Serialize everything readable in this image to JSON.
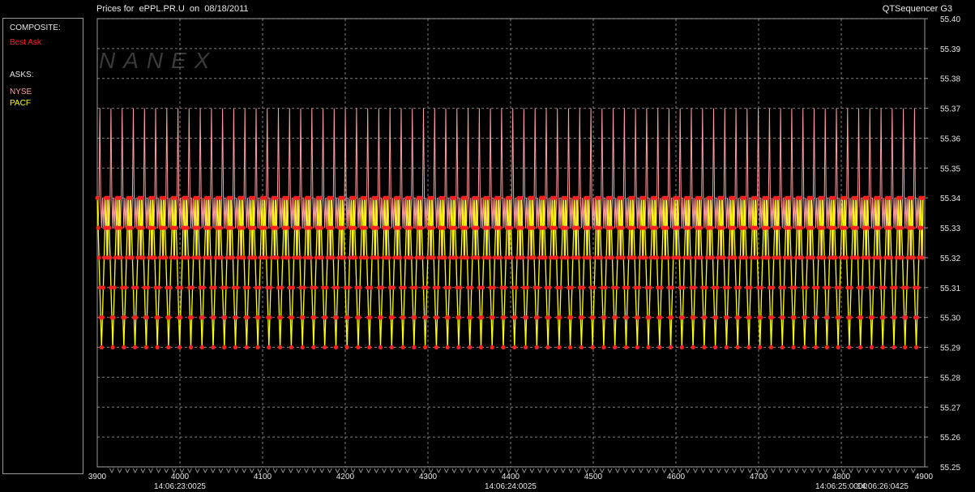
{
  "header": {
    "title": "Prices for  ePPL.PR.U  on  08/18/2011",
    "brand": "QTSequencer G3"
  },
  "legend": {
    "composite_heading": "COMPOSITE:",
    "composite_items": [
      {
        "label": "Best Ask",
        "color": "#ff2020"
      }
    ],
    "asks_heading": "ASKS:",
    "ask_items": [
      {
        "label": "NYSE",
        "color": "#ff9e9e"
      },
      {
        "label": "PACF",
        "color": "#ffff00"
      }
    ]
  },
  "watermark": "NANEX",
  "chart_data": {
    "type": "line",
    "title": "Prices for  ePPL.PR.U  on  08/18/2011",
    "xlabel": "",
    "ylabel": "",
    "x_range": [
      3900,
      4900
    ],
    "ylim": [
      55.25,
      55.4
    ],
    "x_ticks": [
      3900,
      4000,
      4100,
      4200,
      4300,
      4400,
      4500,
      4600,
      4700,
      4800,
      4900
    ],
    "y_ticks": [
      55.25,
      55.26,
      55.27,
      55.28,
      55.29,
      55.3,
      55.31,
      55.32,
      55.33,
      55.34,
      55.35,
      55.36,
      55.37,
      55.38,
      55.39,
      55.4
    ],
    "time_labels": [
      {
        "x": 4000,
        "text": "14:06:23:0025"
      },
      {
        "x": 4400,
        "text": "14:06:24:0025"
      },
      {
        "x": 4800,
        "text": "14:06:25:0000"
      },
      {
        "x": 4850,
        "text": "14:06:26:0425"
      }
    ],
    "grid": true,
    "legend_position": "left panel",
    "colors": {
      "best_ask": "#ff2020",
      "nyse": "#ff9e9e",
      "pacf": "#ffff00",
      "grid": "#b4b4b4",
      "axis_text": "#e6e6e6"
    },
    "cycle_length": 13.5,
    "series": [
      {
        "name": "NYSE",
        "values": [
          55.34,
          55.33,
          55.34,
          55.37,
          55.34,
          55.33,
          55.34,
          55.33,
          55.34,
          55.33,
          55.34,
          55.32,
          55.34
        ]
      },
      {
        "name": "PACF",
        "values": [
          55.34,
          55.33,
          55.32,
          55.31,
          55.3,
          55.29,
          55.3,
          55.31,
          55.32,
          55.33,
          55.34,
          55.33,
          55.32
        ]
      },
      {
        "name": "Best Ask",
        "values": [
          55.34,
          55.33,
          55.32,
          55.31,
          55.3,
          55.29,
          55.3,
          55.31,
          55.32,
          55.33,
          55.34,
          55.33,
          55.32
        ]
      }
    ]
  }
}
